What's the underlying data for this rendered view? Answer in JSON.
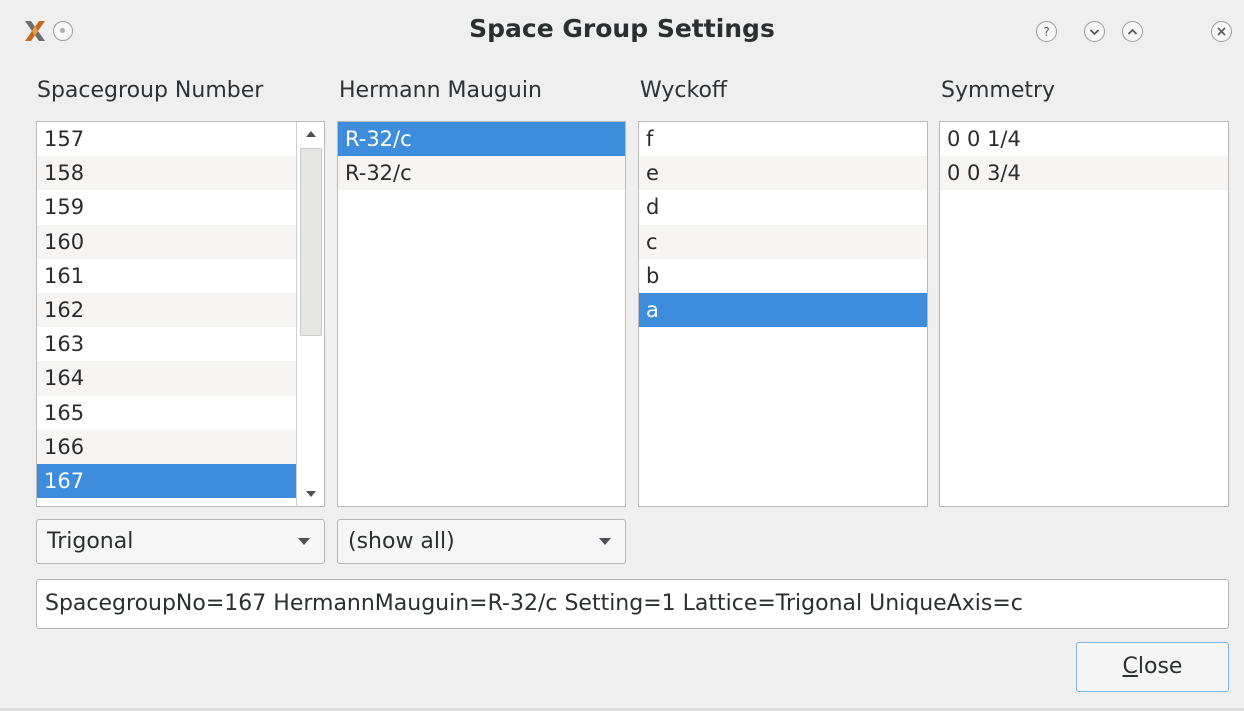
{
  "window": {
    "title": "Space Group Settings"
  },
  "columns": {
    "spacegroup_label": "Spacegroup Number",
    "hermann_label": "Hermann Mauguin",
    "wyckoff_label": "Wyckoff",
    "symmetry_label": "Symmetry"
  },
  "spacegroup_list": {
    "items": [
      "157",
      "158",
      "159",
      "160",
      "161",
      "162",
      "163",
      "164",
      "165",
      "166",
      "167"
    ],
    "selected": "167"
  },
  "hermann_list": {
    "items": [
      "R-32/c",
      "R-32/c"
    ],
    "selected_index": 0
  },
  "wyckoff_list": {
    "items": [
      "f",
      "e",
      "d",
      "c",
      "b",
      "a"
    ],
    "selected": "a"
  },
  "symmetry_list": {
    "items": [
      "0 0 1/4",
      "0 0 3/4"
    ]
  },
  "filters": {
    "crystal_system": "Trigonal",
    "setting_filter": "(show all)"
  },
  "summary": {
    "text": "SpacegroupNo=167 HermannMauguin=R-32/c Setting=1 Lattice=Trigonal UniqueAxis=c"
  },
  "buttons": {
    "close_mnemonic": "C",
    "close_rest": "lose"
  },
  "colors": {
    "selection": "#3e8ddd",
    "window_bg": "#efefef",
    "focus_border": "#7fb3e6"
  }
}
